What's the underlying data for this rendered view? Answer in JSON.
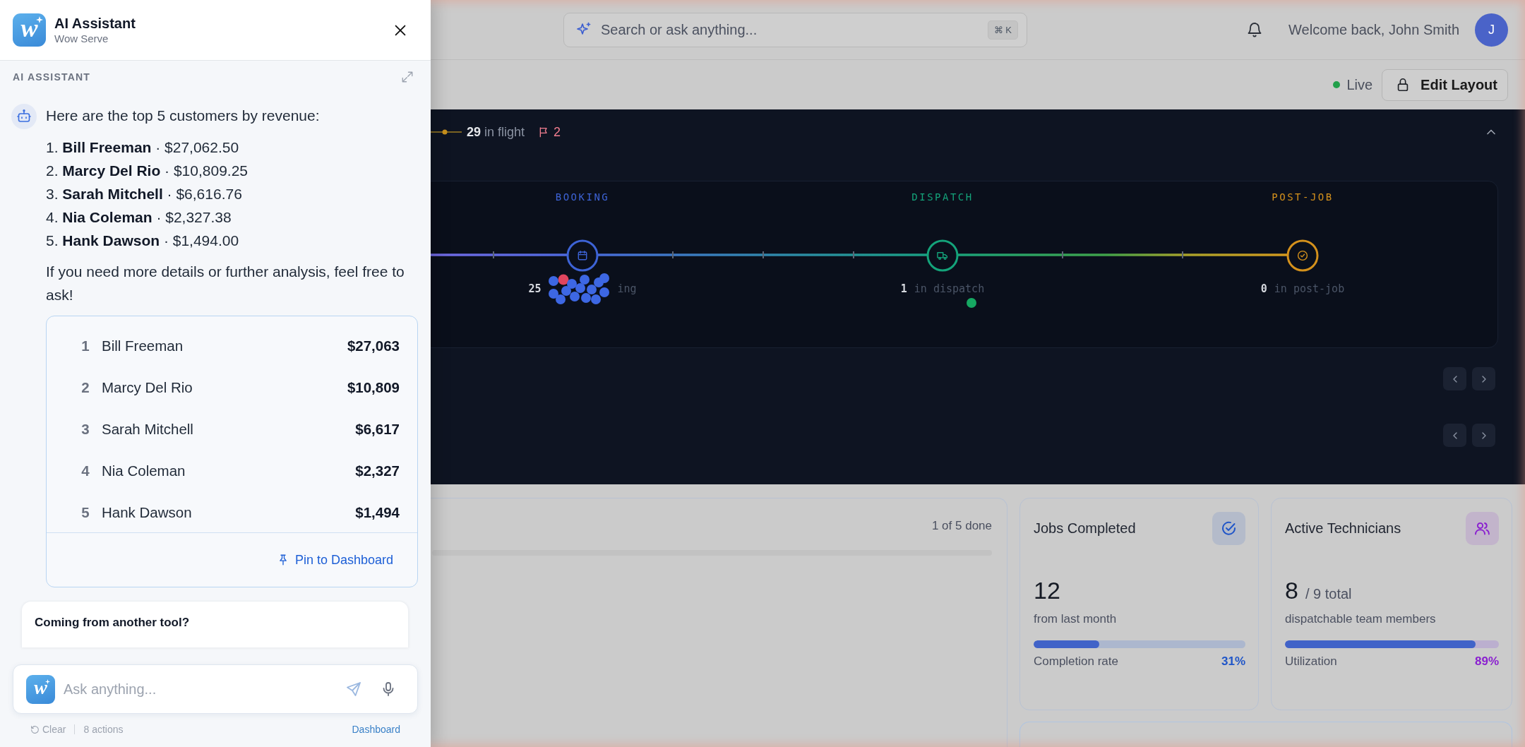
{
  "assistant_panel": {
    "logo": "w",
    "title": "AI Assistant",
    "subtitle": "Wow Serve",
    "section_label": "AI ASSISTANT",
    "message": {
      "intro": "Here are the top 5 customers by revenue:",
      "items": [
        "1. **Bill Freeman** · $27,062.50",
        "2. **Marcy Del Rio** · $10,809.25",
        "3. **Sarah Mitchell** · $6,616.76",
        "4. **Nia Coleman** · $2,327.38",
        "5. **Hank Dawson** · $1,494.00"
      ],
      "closing": "If you need more details or further analysis, feel free to ask!"
    },
    "result_card": {
      "rows": [
        {
          "rank": "1",
          "name": "Bill Freeman",
          "amount": "$27,063"
        },
        {
          "rank": "2",
          "name": "Marcy Del Rio",
          "amount": "$10,809"
        },
        {
          "rank": "3",
          "name": "Sarah Mitchell",
          "amount": "$6,617"
        },
        {
          "rank": "4",
          "name": "Nia Coleman",
          "amount": "$2,327"
        },
        {
          "rank": "5",
          "name": "Hank Dawson",
          "amount": "$1,494"
        }
      ],
      "action": "Pin to Dashboard"
    },
    "tip_card": {
      "title": "Coming from another tool?"
    },
    "composer": {
      "logo": "w",
      "placeholder": "Ask anything..."
    },
    "footer": {
      "clear": "Clear",
      "actions": "8 actions",
      "link": "Dashboard"
    }
  },
  "top_bar": {
    "search": {
      "placeholder": "Search or ask anything...",
      "shortcut": "⌘ K"
    },
    "welcome": "Welcome back, John Smith",
    "avatar": "J"
  },
  "toolbar": {
    "status": {
      "label": "Live",
      "on": true
    },
    "edit_button": "Edit Layout"
  },
  "pipeline": {
    "in_flight": "**29** in flight",
    "flag_count": "2",
    "expanded": true,
    "stages": [
      {
        "label": "BOOKING",
        "color": "#3d63d6",
        "count": "25",
        "caption": "ing",
        "markers": [
          {
            "color": "#e0455e"
          },
          {
            "color": "#3d67e3"
          },
          {
            "color": "#3d67e3"
          },
          {
            "color": "#3d67e3"
          },
          {
            "color": "#3d67e3"
          },
          {
            "color": "#3d67e3"
          },
          {
            "color": "#3d67e3"
          },
          {
            "color": "#3d67e3"
          },
          {
            "color": "#3d67e3"
          },
          {
            "color": "#3d67e3"
          },
          {
            "color": "#3d67e3"
          },
          {
            "color": "#3d67e3"
          },
          {
            "color": "#3d67e3"
          },
          {
            "color": "#3d67e3"
          },
          {
            "color": "#3d67e3"
          }
        ]
      },
      {
        "label": "DISPATCH",
        "color": "#14a37a",
        "count": "1",
        "caption": "in dispatch",
        "markers": [
          {
            "color": "#16a862"
          }
        ]
      },
      {
        "label": "POST-JOB",
        "color": "#d4911c",
        "count": "0",
        "caption": "in post-job"
      }
    ]
  },
  "progress_card": {
    "status": "1 of 5 done"
  },
  "stats": [
    {
      "title": "Jobs Completed",
      "color": "#1f55c8",
      "value": "12",
      "note": "from last month",
      "level": 0.31,
      "metric": "Completion rate",
      "percent": "31%"
    },
    {
      "title": "Active Technicians",
      "color": "#8a1fd0",
      "value": "8",
      "suffix": "/ 9 total",
      "note": "dispatchable team members",
      "level": 0.89,
      "metric": "Utilization",
      "percent": "89%"
    }
  ]
}
